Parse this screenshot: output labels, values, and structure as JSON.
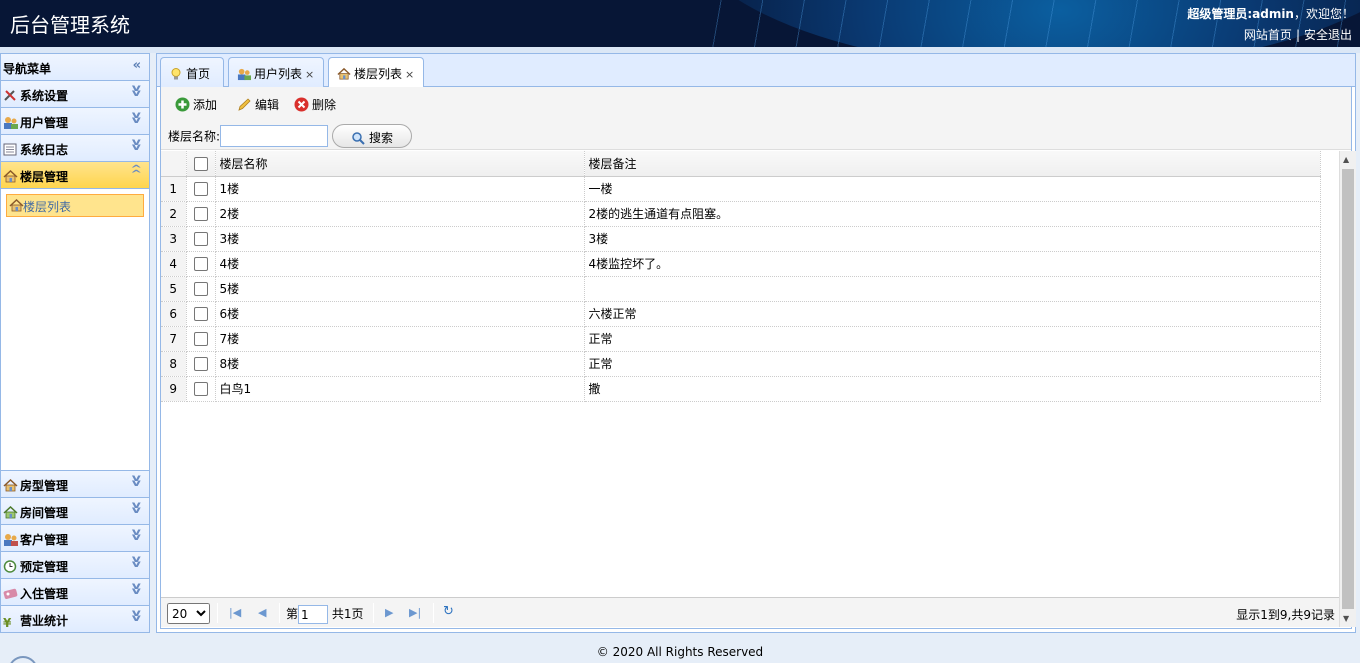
{
  "header": {
    "title": "后台管理系统",
    "welcome_user": "超级管理员:admin",
    "welcome_rest": "，欢迎您！",
    "links": [
      "网站首页",
      "安全退出"
    ],
    "link_separator": "|"
  },
  "sidebar": {
    "title": "导航菜单",
    "menus_top": [
      {
        "label": "系统设置",
        "icon": "tools-icon"
      },
      {
        "label": "用户管理",
        "icon": "users-icon"
      },
      {
        "label": "系统日志",
        "icon": "log-icon"
      }
    ],
    "active_menu": {
      "label": "楼层管理",
      "icon": "house-icon",
      "sub_items": [
        {
          "label": "楼层列表",
          "icon": "house-icon"
        }
      ]
    },
    "menus_bottom": [
      {
        "label": "房型管理",
        "icon": "house-icon"
      },
      {
        "label": "房间管理",
        "icon": "house-icon"
      },
      {
        "label": "客户管理",
        "icon": "users-icon"
      },
      {
        "label": "预定管理",
        "icon": "clock-icon"
      },
      {
        "label": "入住管理",
        "icon": "checkin-icon"
      },
      {
        "label": "营业统计",
        "icon": "yen-icon"
      }
    ]
  },
  "tabs": [
    {
      "label": "首页",
      "icon": "bulb-icon",
      "closable": false
    },
    {
      "label": "用户列表",
      "icon": "users-icon",
      "closable": true
    },
    {
      "label": "楼层列表",
      "icon": "house-icon",
      "closable": true,
      "active": true
    }
  ],
  "tab_close": "×",
  "toolbar": {
    "add_label": "添加",
    "edit_label": "编辑",
    "delete_label": "删除",
    "search_label": "楼层名称:",
    "search_value": "",
    "search_button": "搜索"
  },
  "grid": {
    "columns": [
      "楼层名称",
      "楼层备注"
    ],
    "rows": [
      {
        "num": "1",
        "name": "1楼",
        "remark": "一楼"
      },
      {
        "num": "2",
        "name": "2楼",
        "remark": "2楼的逃生通道有点阻塞。"
      },
      {
        "num": "3",
        "name": "3楼",
        "remark": "3楼"
      },
      {
        "num": "4",
        "name": "4楼",
        "remark": "4楼监控坏了。"
      },
      {
        "num": "5",
        "name": "5楼",
        "remark": ""
      },
      {
        "num": "6",
        "name": "6楼",
        "remark": "六楼正常"
      },
      {
        "num": "7",
        "name": "7楼",
        "remark": "正常"
      },
      {
        "num": "8",
        "name": "8楼",
        "remark": "正常"
      },
      {
        "num": "9",
        "name": "白鸟1",
        "remark": "撒"
      }
    ]
  },
  "pager": {
    "page_size": "20",
    "page_prefix": "第",
    "page_value": "1",
    "page_suffix": "共1页",
    "info": "显示1到9,共9记录"
  },
  "footer": {
    "text": "© 2020 All Rights Reserved"
  },
  "colors": {
    "header_bg": "#071636",
    "panel_border": "#95b8e7",
    "active_yellow": "#ffe48d"
  }
}
